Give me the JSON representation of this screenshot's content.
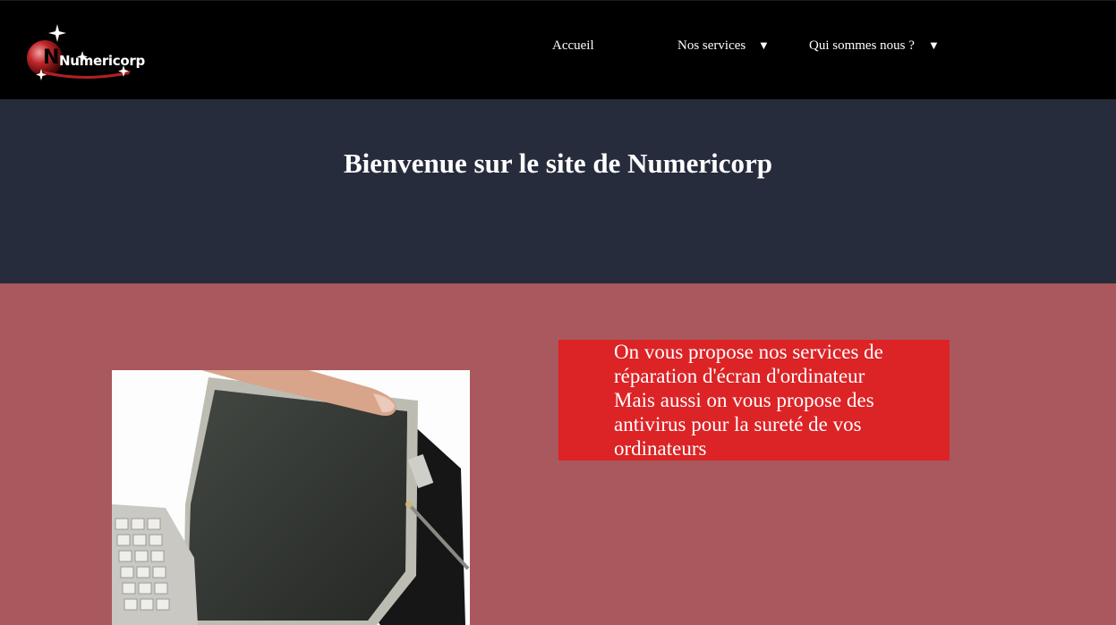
{
  "header": {
    "logo_text": "Numericorp",
    "nav": {
      "home": "Accueil",
      "services": "Nos services",
      "about": "Qui sommes nous ?"
    },
    "dropdown_icon": "▼"
  },
  "hero": {
    "title": "Bienvenue sur le site de Numericorp"
  },
  "main": {
    "info_text": "On vous propose nos services de réparation d'écran d'ordinateur Mais aussi on vous propose des antivirus pour la sureté de vos ordinateurs",
    "photo_alt": "laptop-screen-repair"
  },
  "colors": {
    "topbar": "#000000",
    "hero": "#262c3c",
    "page": "#a9585d",
    "info_box": "#dc2326"
  }
}
